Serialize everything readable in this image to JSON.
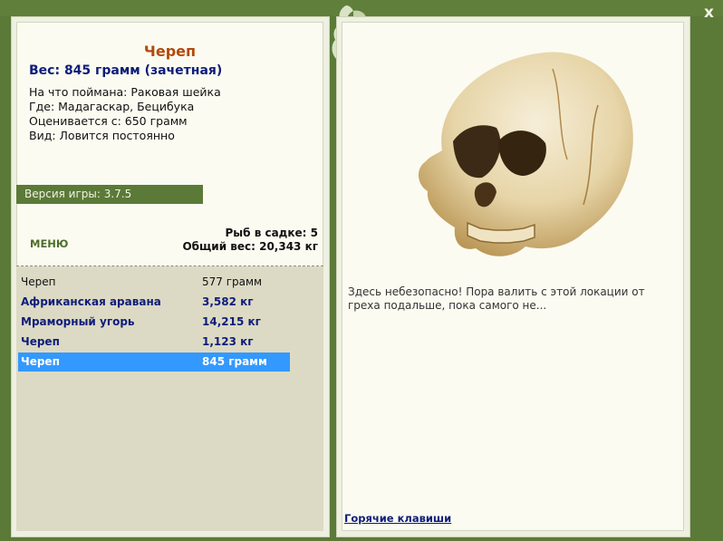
{
  "window": {
    "close_label": "x"
  },
  "fish": {
    "name": "Череп",
    "weight_line": "Вес: 845 грамм (зачетная)",
    "caught_on": "На что поймана: Раковая шейка",
    "location": "Где: Мадагаскар, Бецибука",
    "valued_from": "Оценивается с: 650 грамм",
    "kind": "Вид: Ловится постоянно"
  },
  "version": "Версия игры: 3.7.5",
  "menu_label": "МЕНЮ",
  "keepnet": {
    "count": "Рыб в садке: 5",
    "total_weight": "Общий вес: 20,343 кг"
  },
  "catches": [
    {
      "name": "Череп",
      "weight": "577 грамм",
      "style": "normal"
    },
    {
      "name": "Африканская аравана",
      "weight": "3,582 кг",
      "style": "bold"
    },
    {
      "name": "Мраморный угорь",
      "weight": "14,215 кг",
      "style": "bold"
    },
    {
      "name": "Череп",
      "weight": "1,123 кг",
      "style": "bold"
    },
    {
      "name": "Череп",
      "weight": "845 грамм",
      "style": "selected"
    }
  ],
  "message": "Здесь небезопасно! Пора валить с этой локации от греха подальше, пока самого не...",
  "hotkeys_label": "Горячие клавиши",
  "colors": {
    "frame": "#5b7a38",
    "title": "#b24a0d",
    "highlight": "#3399ff",
    "link": "#0e1d7a"
  }
}
